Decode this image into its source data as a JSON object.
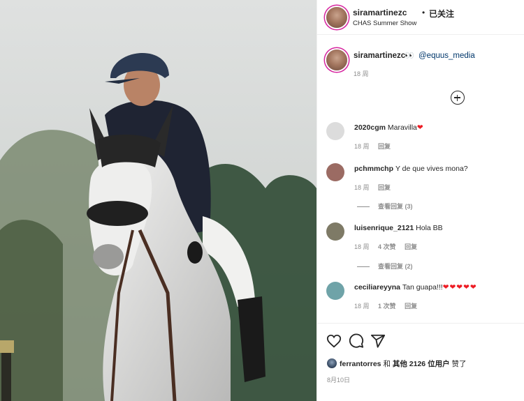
{
  "post": {
    "username": "siramartinezc",
    "dot": "•",
    "follow_status": "已关注",
    "location": "CHAS Summer Show",
    "caption_eyes": "👀",
    "caption_mention": "@equus_media",
    "caption_time": "18 周"
  },
  "comments": [
    {
      "user": "2020cgm",
      "text": "Maravilla",
      "emoji": "❤",
      "time": "18 周",
      "likes": "",
      "reply": "回复",
      "view_replies": "",
      "avatar_color": "#d8d8d8"
    },
    {
      "user": "pchmmchp",
      "text": "Y de que vives mona?",
      "emoji": "",
      "time": "18 周",
      "likes": "",
      "reply": "回复",
      "view_replies": "查看回复 (3)",
      "avatar_color": "#9b6b63"
    },
    {
      "user": "luisenrique_2121",
      "text": "Hola BB",
      "emoji": "",
      "time": "18 周",
      "likes": "4 次赞",
      "reply": "回复",
      "view_replies": "查看回复 (2)",
      "avatar_color": "#7e7a66"
    },
    {
      "user": "ceciliareyyna",
      "text": "Tan guapa!!!",
      "emoji": "❤❤❤❤❤",
      "time": "18 周",
      "likes": "1 次赞",
      "reply": "回复",
      "view_replies": "",
      "avatar_color": "#6fa3a8"
    }
  ],
  "footer": {
    "liker": "ferrantorres",
    "and": "和",
    "others": "其他 2126 位用户",
    "liked": "赞了",
    "date": "8月10日"
  },
  "icons": {
    "like": "heart-outline-icon",
    "comment": "speech-bubble-icon",
    "share": "paper-plane-icon",
    "add": "plus-circle-icon"
  },
  "colors": {
    "mention": "#00376b",
    "heart": "#ed1c24",
    "story_ring": "#d6249f",
    "meta": "#8e8e8e"
  }
}
